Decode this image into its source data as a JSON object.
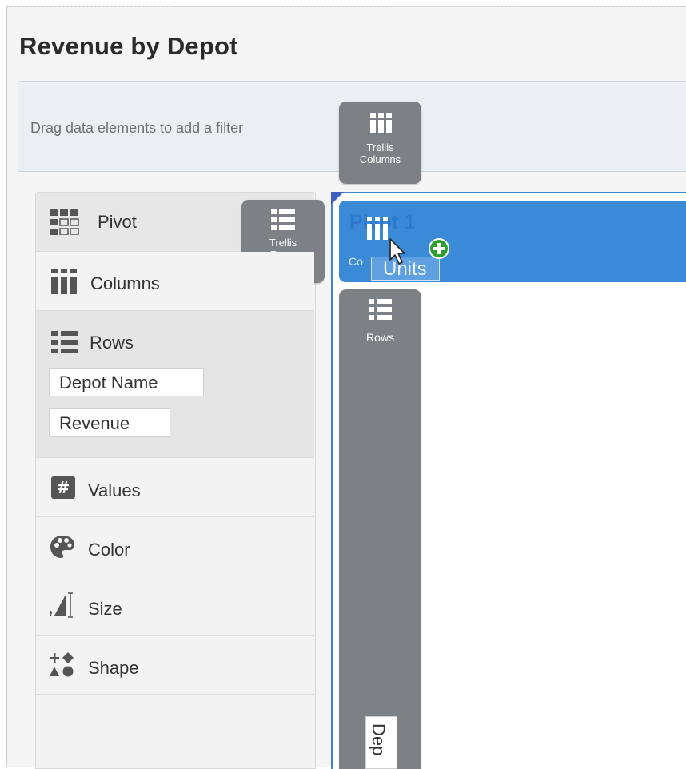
{
  "title": "Revenue by Depot",
  "filter_bar": {
    "hint": "Drag data elements to add a filter"
  },
  "drop_targets": {
    "trellis_columns": [
      "Trellis",
      "Columns"
    ],
    "trellis_rows": [
      "Trellis",
      "Rows"
    ],
    "rows": "Rows"
  },
  "grammar": {
    "pivot": "Pivot",
    "columns": "Columns",
    "rows": "Rows",
    "rows_items": [
      "Depot Name",
      "Revenue"
    ],
    "values": "Values",
    "color": "Color",
    "size": "Size",
    "shape": "Shape"
  },
  "canvas": {
    "title": "Pivot 1",
    "drag_partial_label": "Co",
    "dragged_item": "Units",
    "rows_chip": "Dep"
  },
  "colors": {
    "accent": "#3a8ad8",
    "drop_target": "#7d8185",
    "add_badge": "#2e9e2e"
  }
}
